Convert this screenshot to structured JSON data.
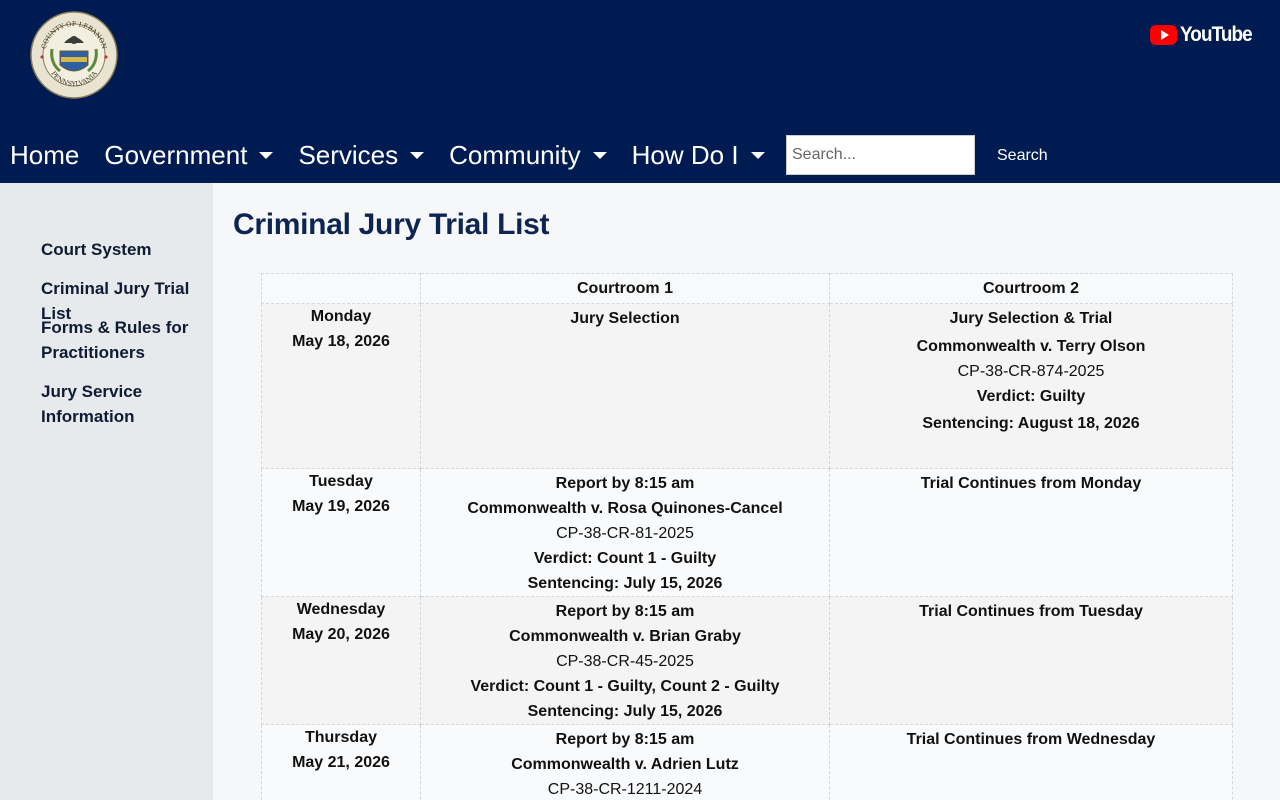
{
  "header": {
    "seal_text": {
      "top": "COUNTY OF LEBANON",
      "bottom": "PENNSYLVANIA"
    },
    "youtube_label": "YouTube",
    "nav": [
      {
        "label": "Home",
        "dropdown": false
      },
      {
        "label": "Government",
        "dropdown": true
      },
      {
        "label": "Services",
        "dropdown": true
      },
      {
        "label": "Community",
        "dropdown": true
      },
      {
        "label": "How Do I",
        "dropdown": true
      }
    ],
    "search": {
      "placeholder": "Search...",
      "value": "",
      "button_label": "Search"
    }
  },
  "sidebar": {
    "items": [
      {
        "label": "Court System"
      },
      {
        "label": "Criminal Jury Trial List"
      },
      {
        "label": "Forms & Rules for Practitioners"
      },
      {
        "label": "Jury Service Information"
      }
    ]
  },
  "main": {
    "title": "Criminal Jury Trial List",
    "table": {
      "headers": [
        "",
        "Courtroom 1",
        "Courtroom 2"
      ],
      "rows": [
        {
          "day": "Monday",
          "date": "May 18, 2026",
          "c1": [
            {
              "text": "Jury Selection",
              "bold": true
            }
          ],
          "c2": [
            {
              "text": "Jury Selection & Trial",
              "bold": true
            },
            {
              "text": "Commonwealth v. Terry Olson",
              "bold": true
            },
            {
              "text": "CP-38-CR-874-2025",
              "bold": false
            },
            {
              "text": "Verdict:  Guilty",
              "bold": true
            },
            {
              "text": "Sentencing:  August 18, 2026",
              "bold": true
            }
          ]
        },
        {
          "day": "Tuesday",
          "date": "May 19, 2026",
          "c1": [
            {
              "text": "Report by 8:15 am",
              "bold": true
            },
            {
              "text": "Commonwealth v. Rosa Quinones-Cancel",
              "bold": true
            },
            {
              "text": "CP-38-CR-81-2025",
              "bold": false
            },
            {
              "text": "Verdict: Count 1 - Guilty",
              "bold": true
            },
            {
              "text": "Sentencing:  July 15, 2026",
              "bold": true
            }
          ],
          "c2": [
            {
              "text": "Trial Continues from Monday",
              "bold": true
            }
          ]
        },
        {
          "day": "Wednesday",
          "date": "May 20, 2026",
          "c1": [
            {
              "text": "Report by 8:15 am",
              "bold": true
            },
            {
              "text": "Commonwealth v. Brian Graby",
              "bold": true
            },
            {
              "text": "CP-38-CR-45-2025",
              "bold": false
            },
            {
              "text": "Verdict: Count 1 - Guilty, Count 2 - Guilty",
              "bold": true
            },
            {
              "text": "Sentencing: July 15, 2026",
              "bold": true
            }
          ],
          "c2": [
            {
              "text": "Trial Continues from Tuesday",
              "bold": true
            }
          ]
        },
        {
          "day": "Thursday",
          "date": "May 21, 2026",
          "c1": [
            {
              "text": "Report by 8:15 am",
              "bold": true
            },
            {
              "text": "Commonwealth v. Adrien Lutz",
              "bold": true
            },
            {
              "text": "CP-38-CR-1211-2024",
              "bold": false
            }
          ],
          "c2": [
            {
              "text": "Trial Continues from Wednesday",
              "bold": true
            }
          ]
        }
      ]
    }
  },
  "colors": {
    "header_bg": "#001b52",
    "title": "#0d2550",
    "youtube_red": "#ff0000"
  },
  "icons": {
    "seal": "county-seal-icon",
    "youtube": "youtube-icon",
    "dropdown": "chevron-down-icon"
  }
}
